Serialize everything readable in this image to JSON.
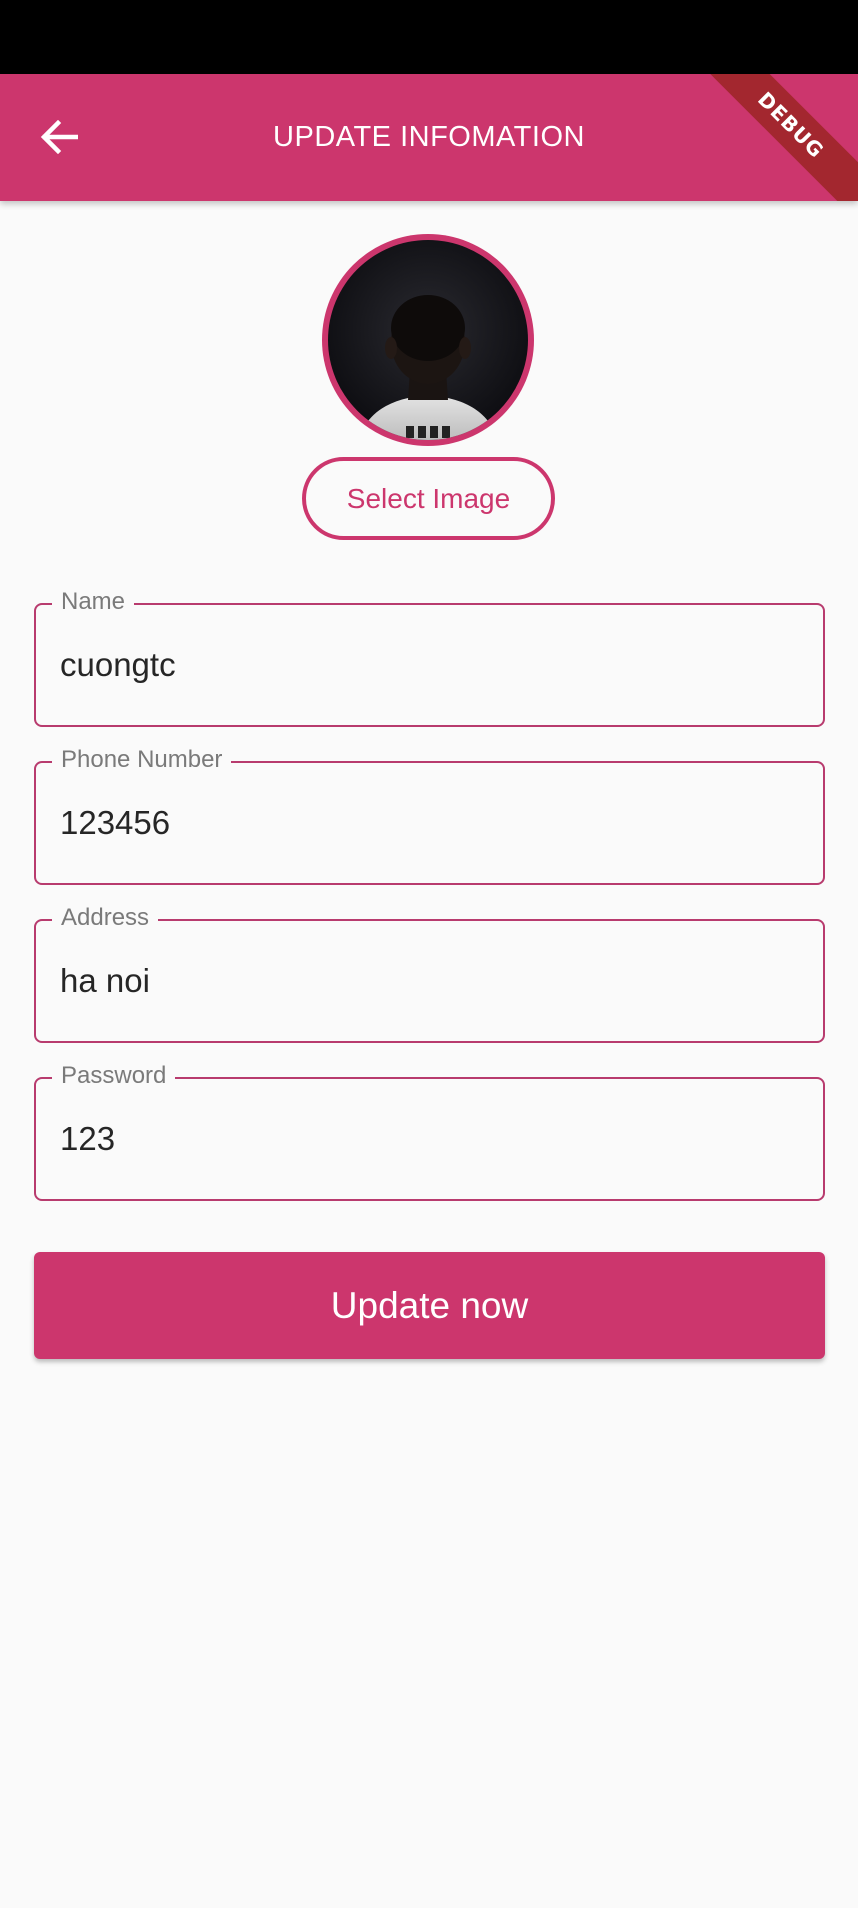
{
  "app_bar": {
    "title": "UPDATE INFOMATION",
    "back_icon": "arrow-back-icon",
    "debug_banner": "DEBUG",
    "color": "#cc366d"
  },
  "avatar": {
    "description": "profile-photo",
    "ring_color": "#cc366d"
  },
  "select_image_label": "Select Image",
  "form": {
    "fields": [
      {
        "label": "Name",
        "value": "cuongtc"
      },
      {
        "label": "Phone Number",
        "value": "123456"
      },
      {
        "label": "Address",
        "value": "ha noi"
      },
      {
        "label": "Password",
        "value": "123"
      }
    ]
  },
  "update_label": "Update now"
}
